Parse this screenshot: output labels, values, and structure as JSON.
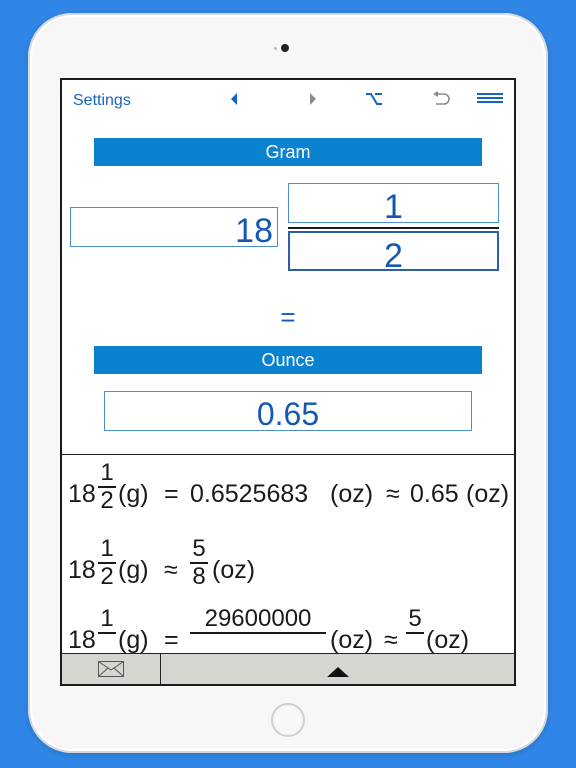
{
  "toolbar": {
    "settings_label": "Settings",
    "icons": [
      "arrow-left-icon",
      "arrow-right-icon",
      "option-key-icon",
      "undo-icon",
      "menu-icon"
    ],
    "accent": "#1565c0"
  },
  "converter": {
    "from_unit": "Gram",
    "whole": "18",
    "numerator": "1",
    "denominator": "2",
    "equals": "=",
    "to_unit": "Ounce",
    "result": "0.65",
    "bar_color": "#0a82cf"
  },
  "results": [
    {
      "whole": "18",
      "num": "1",
      "den": "2",
      "from_unit": "(g)",
      "relation": "=",
      "decimal": "0.6525683",
      "to_unit": "(oz)",
      "approx": "≈",
      "rounded": "0.65",
      "rounded_unit": "(oz)"
    },
    {
      "whole": "18",
      "num": "1",
      "den": "2",
      "from_unit": "(g)",
      "approx": "≈",
      "num2": "5",
      "den2": "8",
      "to_unit": "(oz)"
    },
    {
      "whole": "18",
      "num": "1",
      "from_unit": "(g)",
      "relation": "=",
      "big_num": "29600000",
      "to_unit": "(oz)",
      "approx": "≈",
      "num2": "5",
      "to_unit2": "(oz)"
    }
  ],
  "bottom_bar": {
    "icons": [
      "mail-icon",
      "triangle-up-icon"
    ],
    "background": "#d7d5cf"
  }
}
